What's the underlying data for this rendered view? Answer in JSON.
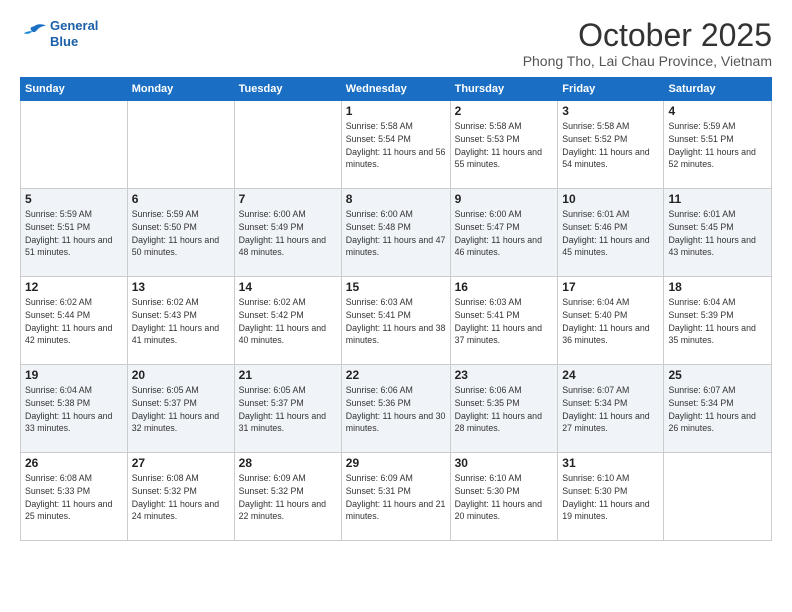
{
  "header": {
    "logo_line1": "General",
    "logo_line2": "Blue",
    "month": "October 2025",
    "location": "Phong Tho, Lai Chau Province, Vietnam"
  },
  "weekdays": [
    "Sunday",
    "Monday",
    "Tuesday",
    "Wednesday",
    "Thursday",
    "Friday",
    "Saturday"
  ],
  "weeks": [
    [
      {
        "day": "",
        "sunrise": "",
        "sunset": "",
        "daylight": ""
      },
      {
        "day": "",
        "sunrise": "",
        "sunset": "",
        "daylight": ""
      },
      {
        "day": "",
        "sunrise": "",
        "sunset": "",
        "daylight": ""
      },
      {
        "day": "1",
        "sunrise": "Sunrise: 5:58 AM",
        "sunset": "Sunset: 5:54 PM",
        "daylight": "Daylight: 11 hours and 56 minutes."
      },
      {
        "day": "2",
        "sunrise": "Sunrise: 5:58 AM",
        "sunset": "Sunset: 5:53 PM",
        "daylight": "Daylight: 11 hours and 55 minutes."
      },
      {
        "day": "3",
        "sunrise": "Sunrise: 5:58 AM",
        "sunset": "Sunset: 5:52 PM",
        "daylight": "Daylight: 11 hours and 54 minutes."
      },
      {
        "day": "4",
        "sunrise": "Sunrise: 5:59 AM",
        "sunset": "Sunset: 5:51 PM",
        "daylight": "Daylight: 11 hours and 52 minutes."
      }
    ],
    [
      {
        "day": "5",
        "sunrise": "Sunrise: 5:59 AM",
        "sunset": "Sunset: 5:51 PM",
        "daylight": "Daylight: 11 hours and 51 minutes."
      },
      {
        "day": "6",
        "sunrise": "Sunrise: 5:59 AM",
        "sunset": "Sunset: 5:50 PM",
        "daylight": "Daylight: 11 hours and 50 minutes."
      },
      {
        "day": "7",
        "sunrise": "Sunrise: 6:00 AM",
        "sunset": "Sunset: 5:49 PM",
        "daylight": "Daylight: 11 hours and 48 minutes."
      },
      {
        "day": "8",
        "sunrise": "Sunrise: 6:00 AM",
        "sunset": "Sunset: 5:48 PM",
        "daylight": "Daylight: 11 hours and 47 minutes."
      },
      {
        "day": "9",
        "sunrise": "Sunrise: 6:00 AM",
        "sunset": "Sunset: 5:47 PM",
        "daylight": "Daylight: 11 hours and 46 minutes."
      },
      {
        "day": "10",
        "sunrise": "Sunrise: 6:01 AM",
        "sunset": "Sunset: 5:46 PM",
        "daylight": "Daylight: 11 hours and 45 minutes."
      },
      {
        "day": "11",
        "sunrise": "Sunrise: 6:01 AM",
        "sunset": "Sunset: 5:45 PM",
        "daylight": "Daylight: 11 hours and 43 minutes."
      }
    ],
    [
      {
        "day": "12",
        "sunrise": "Sunrise: 6:02 AM",
        "sunset": "Sunset: 5:44 PM",
        "daylight": "Daylight: 11 hours and 42 minutes."
      },
      {
        "day": "13",
        "sunrise": "Sunrise: 6:02 AM",
        "sunset": "Sunset: 5:43 PM",
        "daylight": "Daylight: 11 hours and 41 minutes."
      },
      {
        "day": "14",
        "sunrise": "Sunrise: 6:02 AM",
        "sunset": "Sunset: 5:42 PM",
        "daylight": "Daylight: 11 hours and 40 minutes."
      },
      {
        "day": "15",
        "sunrise": "Sunrise: 6:03 AM",
        "sunset": "Sunset: 5:41 PM",
        "daylight": "Daylight: 11 hours and 38 minutes."
      },
      {
        "day": "16",
        "sunrise": "Sunrise: 6:03 AM",
        "sunset": "Sunset: 5:41 PM",
        "daylight": "Daylight: 11 hours and 37 minutes."
      },
      {
        "day": "17",
        "sunrise": "Sunrise: 6:04 AM",
        "sunset": "Sunset: 5:40 PM",
        "daylight": "Daylight: 11 hours and 36 minutes."
      },
      {
        "day": "18",
        "sunrise": "Sunrise: 6:04 AM",
        "sunset": "Sunset: 5:39 PM",
        "daylight": "Daylight: 11 hours and 35 minutes."
      }
    ],
    [
      {
        "day": "19",
        "sunrise": "Sunrise: 6:04 AM",
        "sunset": "Sunset: 5:38 PM",
        "daylight": "Daylight: 11 hours and 33 minutes."
      },
      {
        "day": "20",
        "sunrise": "Sunrise: 6:05 AM",
        "sunset": "Sunset: 5:37 PM",
        "daylight": "Daylight: 11 hours and 32 minutes."
      },
      {
        "day": "21",
        "sunrise": "Sunrise: 6:05 AM",
        "sunset": "Sunset: 5:37 PM",
        "daylight": "Daylight: 11 hours and 31 minutes."
      },
      {
        "day": "22",
        "sunrise": "Sunrise: 6:06 AM",
        "sunset": "Sunset: 5:36 PM",
        "daylight": "Daylight: 11 hours and 30 minutes."
      },
      {
        "day": "23",
        "sunrise": "Sunrise: 6:06 AM",
        "sunset": "Sunset: 5:35 PM",
        "daylight": "Daylight: 11 hours and 28 minutes."
      },
      {
        "day": "24",
        "sunrise": "Sunrise: 6:07 AM",
        "sunset": "Sunset: 5:34 PM",
        "daylight": "Daylight: 11 hours and 27 minutes."
      },
      {
        "day": "25",
        "sunrise": "Sunrise: 6:07 AM",
        "sunset": "Sunset: 5:34 PM",
        "daylight": "Daylight: 11 hours and 26 minutes."
      }
    ],
    [
      {
        "day": "26",
        "sunrise": "Sunrise: 6:08 AM",
        "sunset": "Sunset: 5:33 PM",
        "daylight": "Daylight: 11 hours and 25 minutes."
      },
      {
        "day": "27",
        "sunrise": "Sunrise: 6:08 AM",
        "sunset": "Sunset: 5:32 PM",
        "daylight": "Daylight: 11 hours and 24 minutes."
      },
      {
        "day": "28",
        "sunrise": "Sunrise: 6:09 AM",
        "sunset": "Sunset: 5:32 PM",
        "daylight": "Daylight: 11 hours and 22 minutes."
      },
      {
        "day": "29",
        "sunrise": "Sunrise: 6:09 AM",
        "sunset": "Sunset: 5:31 PM",
        "daylight": "Daylight: 11 hours and 21 minutes."
      },
      {
        "day": "30",
        "sunrise": "Sunrise: 6:10 AM",
        "sunset": "Sunset: 5:30 PM",
        "daylight": "Daylight: 11 hours and 20 minutes."
      },
      {
        "day": "31",
        "sunrise": "Sunrise: 6:10 AM",
        "sunset": "Sunset: 5:30 PM",
        "daylight": "Daylight: 11 hours and 19 minutes."
      },
      {
        "day": "",
        "sunrise": "",
        "sunset": "",
        "daylight": ""
      }
    ]
  ]
}
